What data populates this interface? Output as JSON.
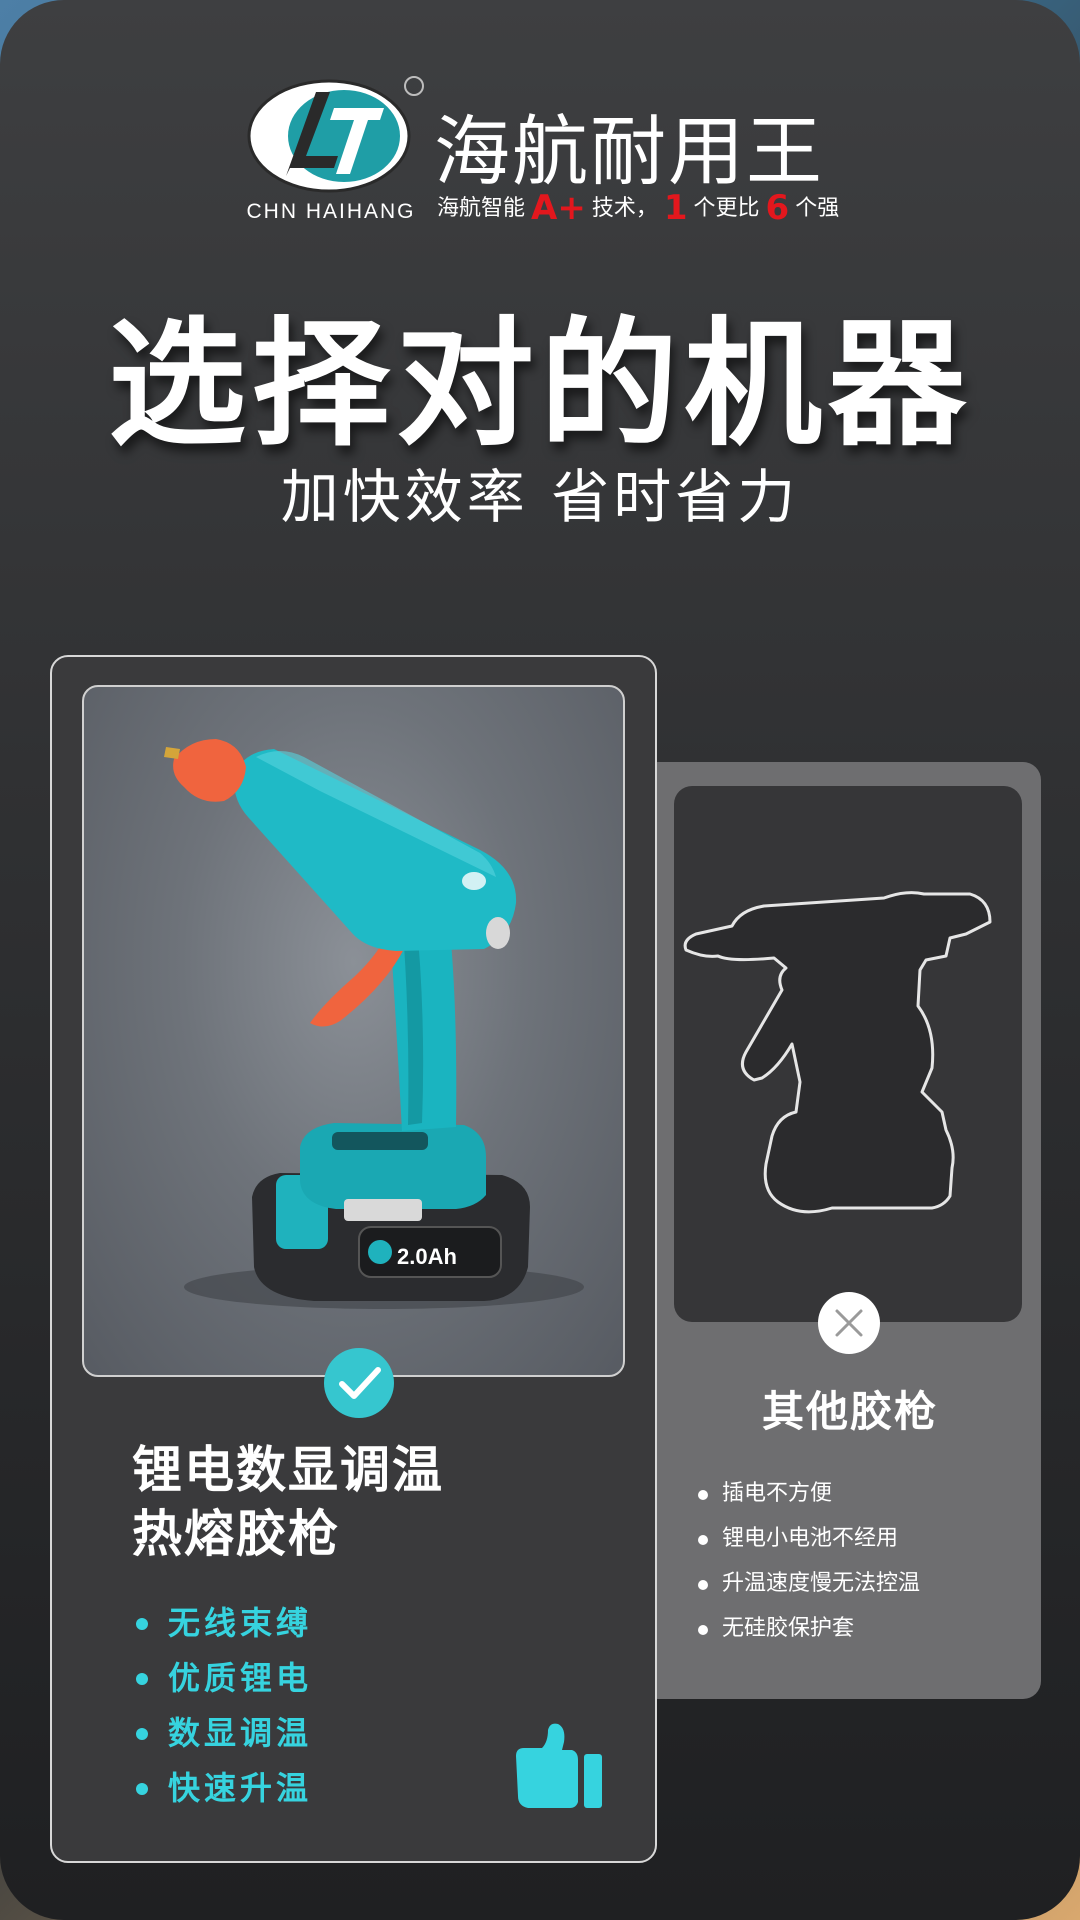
{
  "brand": {
    "logo_text_en": "CHN HAIHANG",
    "name_cn": "海航耐用王",
    "slogan": {
      "part1": "海航智能",
      "grade": "A+",
      "part2": "技术，",
      "num1": "1",
      "part3": "个更比",
      "num2": "6",
      "part4": "个强"
    },
    "colors": {
      "teal": "#36c6cf",
      "red": "#e3171d"
    }
  },
  "headline": "选择对的机器",
  "subheadline": "加快效率 省时省力",
  "product": {
    "title_line1": "锂电数显调温",
    "title_line2": "热熔胶枪",
    "features": [
      "无线束缚",
      "优质锂电",
      "数显调温",
      "快速升温"
    ],
    "battery_label": "2.0Ah",
    "badge_icon": "check-icon",
    "thumb_icon": "thumbs-up-icon"
  },
  "other": {
    "title": "其他胶枪",
    "drawbacks": [
      "插电不方便",
      "锂电小电池不经用",
      "升温速度慢无法控温",
      "无硅胶保护套"
    ],
    "badge_icon": "x-icon"
  }
}
